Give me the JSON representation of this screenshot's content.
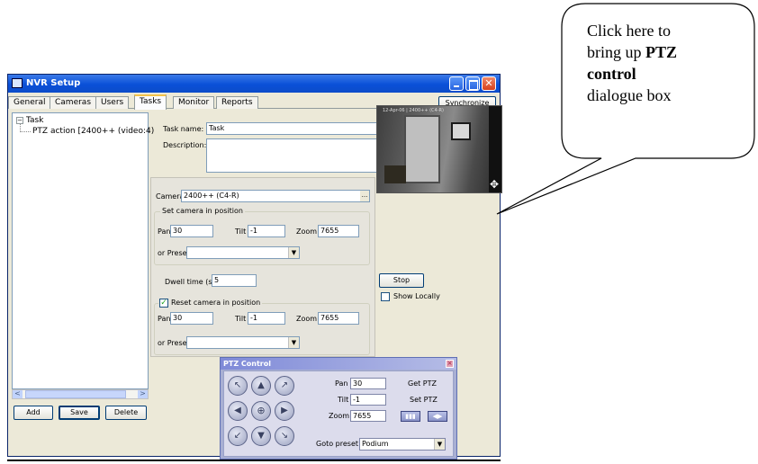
{
  "window": {
    "title": "NVR Setup",
    "close_glyph": "✕"
  },
  "tabs": [
    "General",
    "Cameras",
    "Users",
    "Tasks",
    "Monitor",
    "Reports"
  ],
  "active_tab": "Tasks",
  "synchronize_label": "Synchronize",
  "tree": {
    "root": "Task",
    "root_expander": "−",
    "child": "PTZ action [2400++ (video:4)"
  },
  "scroll": {
    "left": "<",
    "right": ">"
  },
  "buttons": {
    "add": "Add",
    "save": "Save",
    "delete": "Delete",
    "stop": "Stop"
  },
  "form": {
    "task_name_label": "Task name:",
    "task_name_value": "Task",
    "description_label": "Description:",
    "description_value": "",
    "camera_label": "Camera",
    "camera_value": "2400++ (C4-R)",
    "ellipsis": "...",
    "set_group_legend": "Set camera in position",
    "pan_label": "Pan",
    "pan_value": "30",
    "tilt_label": "Tilt",
    "tilt_value": "-1",
    "zoom_label": "Zoom",
    "zoom_value": "7655",
    "preset_label": "or Preset",
    "preset_value": "",
    "dwell_label": "Dwell time (s)",
    "dwell_value": "5",
    "reset_label": "Reset camera in position",
    "reset_checked": true,
    "reset_pan_value": "30",
    "reset_tilt_value": "-1",
    "reset_zoom_value": "7655",
    "reset_preset_value": "",
    "show_locally_label": "Show Locally",
    "show_locally_checked": false,
    "check_glyph": "✓"
  },
  "video": {
    "caption": "12-Apr-06 | 2400++ (C4-R)",
    "move_icon_glyph": "✥"
  },
  "ptz_dialog": {
    "title": "PTZ Control",
    "close_glyph": "×",
    "pan_label": "Pan",
    "pan_value": "30",
    "tilt_label": "Tilt",
    "tilt_value": "-1",
    "zoom_label": "Zoom",
    "zoom_value": "7655",
    "get_ptz_label": "Get PTZ",
    "set_ptz_label": "Set PTZ",
    "goto_preset_label": "Goto preset",
    "goto_preset_value": "Podium",
    "arrows": {
      "up_left": "↖",
      "up": "▲",
      "up_right": "↗",
      "left": "◀",
      "center": "⊕",
      "right": "▶",
      "down_left": "↙",
      "down": "▼",
      "down_right": "↘"
    },
    "mini_buttons": [
      "▮▮▮",
      "◀▶"
    ]
  },
  "callout": {
    "line1": "Click here to",
    "line2_prefix": "bring up ",
    "line2_bold": "PTZ",
    "line3_bold": "control",
    "line4": "dialogue box"
  },
  "colors": {
    "titlebar": "#0a50d8",
    "window_bg": "#ece9d8",
    "ptz_frame": "#a8afd3",
    "active_tab_accent": "#f3c34a"
  }
}
